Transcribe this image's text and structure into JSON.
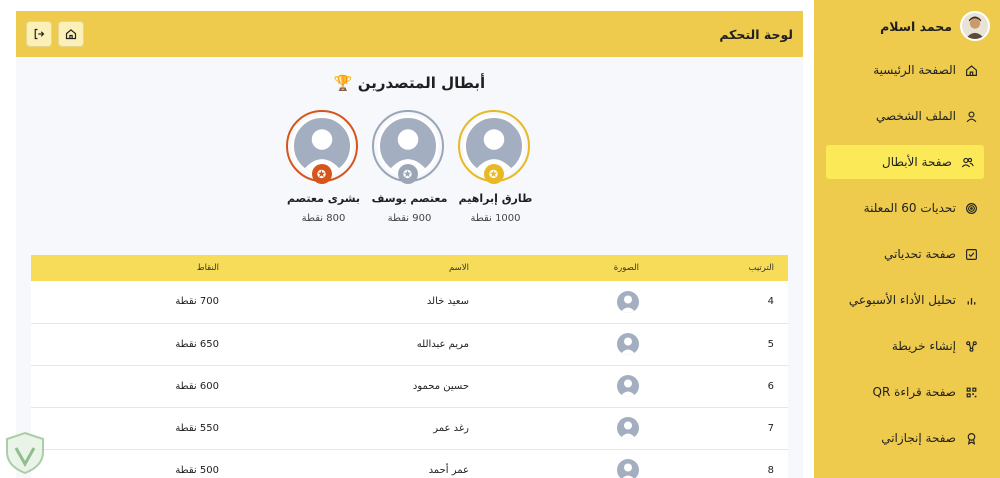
{
  "sidebar": {
    "user_name": "محمد اسلام",
    "items": [
      {
        "label": "الصفحة الرئيسية",
        "icon": "home-icon",
        "active": false
      },
      {
        "label": "الملف الشخصي",
        "icon": "user-icon",
        "active": false
      },
      {
        "label": "صفحة الأبطال",
        "icon": "users-icon",
        "active": true
      },
      {
        "label": "تحديات 60 المعلنة",
        "icon": "target-icon",
        "active": false
      },
      {
        "label": "صفحة تحدياتي",
        "icon": "checkbox-icon",
        "active": false
      },
      {
        "label": "تحليل الأداء الأسبوعي",
        "icon": "bar-chart-icon",
        "active": false
      },
      {
        "label": "إنشاء خريطة",
        "icon": "mindmap-icon",
        "active": false
      },
      {
        "label": "صفحة قراءة QR",
        "icon": "qr-code-icon",
        "active": false
      },
      {
        "label": "صفحة إنجازاتي",
        "icon": "award-icon",
        "active": false
      }
    ]
  },
  "topbar": {
    "title": "لوحة التحكم"
  },
  "main": {
    "title": "أبطال المتصدرين 🏆",
    "champions": [
      {
        "name": "طارق إبراهيم",
        "points": "1000 نقطة",
        "rank": 1,
        "color": "#e8b923"
      },
      {
        "name": "معتصم يوسف",
        "points": "900 نقطة",
        "rank": 2,
        "color": "#9aa5b6"
      },
      {
        "name": "بشرى معتصم",
        "points": "800 نقطة",
        "rank": 3,
        "color": "#d4561c"
      }
    ],
    "table": {
      "headers": {
        "rank": "الترتيب",
        "photo": "الصورة",
        "name": "الاسم",
        "points": "النقاط"
      },
      "rows": [
        {
          "rank": "4",
          "name": "سعيد خالد",
          "points": "700 نقطة"
        },
        {
          "rank": "5",
          "name": "مريم عبدالله",
          "points": "650 نقطة"
        },
        {
          "rank": "6",
          "name": "حسين محمود",
          "points": "600 نقطة"
        },
        {
          "rank": "7",
          "name": "رغد عمر",
          "points": "550 نقطة"
        },
        {
          "rank": "8",
          "name": "عمر أحمد",
          "points": "500 نقطة"
        }
      ]
    }
  },
  "colors": {
    "sidebar_bg": "#eecb4d",
    "active_item_bg": "#fbe958",
    "table_header_bg": "#f7dc5a",
    "gold": "#e8b923",
    "silver": "#9aa5b6",
    "bronze": "#d4561c"
  }
}
